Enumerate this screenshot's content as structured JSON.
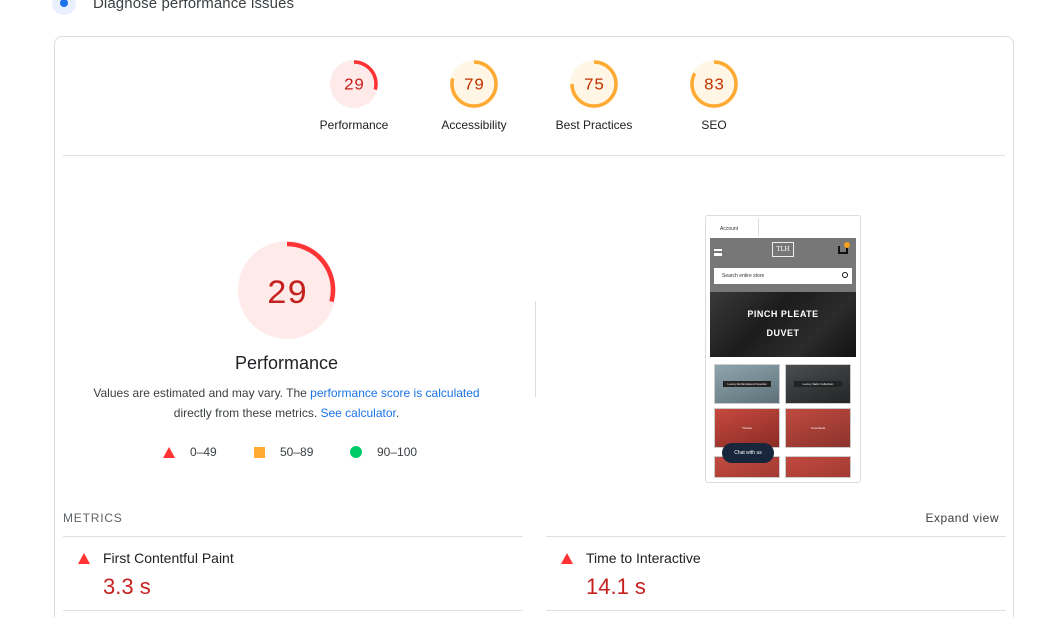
{
  "section": {
    "title": "Diagnose performance issues"
  },
  "colors": {
    "fail": "#ff3333",
    "average": "#ffaa33",
    "pass": "#00cc66",
    "fail_text": "#c5221f",
    "average_text": "#c33300",
    "link": "#1a73e8"
  },
  "gauges": [
    {
      "label": "Performance",
      "score": "29",
      "category": "fail"
    },
    {
      "label": "Accessibility",
      "score": "79",
      "category": "average"
    },
    {
      "label": "Best Practices",
      "score": "75",
      "category": "average"
    },
    {
      "label": "SEO",
      "score": "83",
      "category": "average"
    }
  ],
  "performance": {
    "score": "29",
    "title": "Performance",
    "desc_prefix": "Values are estimated and may vary. The ",
    "desc_link1": "performance score is calculated",
    "desc_middle": " directly from these metrics. ",
    "desc_link2": "See calculator",
    "desc_suffix": "."
  },
  "legend": [
    {
      "shape": "triangle-icon",
      "range": "0–49"
    },
    {
      "shape": "square-icon",
      "range": "50–89"
    },
    {
      "shape": "circle-icon",
      "range": "90–100"
    }
  ],
  "screenshot": {
    "account": "Account",
    "logo": "TLH",
    "search_placeholder": "Search entire store",
    "hero_line1": "PINCH PLEATE",
    "hero_line2": "DUVET",
    "tile1": "Luxury Embroidered Coverlet",
    "tile2": "Luxury Satin Collection",
    "tile3": "Throws",
    "tile4": "Coverbeds",
    "chat": "Chat with us"
  },
  "metrics": {
    "heading": "METRICS",
    "expand": "Expand view",
    "items": [
      {
        "name": "First Contentful Paint",
        "value": "3.3 s"
      },
      {
        "name": "Time to Interactive",
        "value": "14.1 s"
      }
    ]
  }
}
